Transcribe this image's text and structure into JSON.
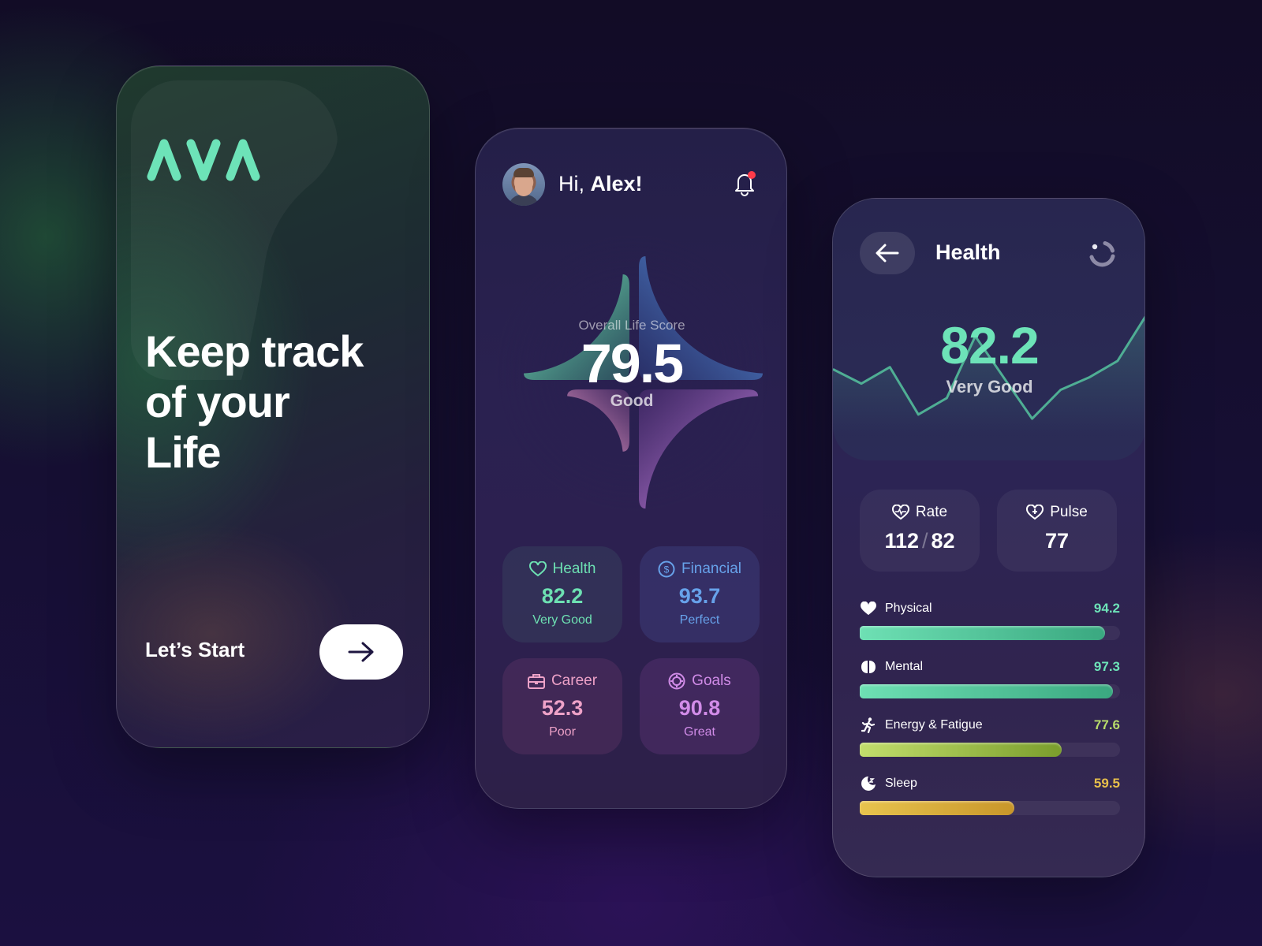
{
  "welcome": {
    "logo": "AVA",
    "headline": [
      "Keep track",
      "of your",
      "Life"
    ],
    "start_label": "Let’s Start",
    "start_button_icon": "arrow-right-icon",
    "accent": "#6de3b8"
  },
  "dashboard": {
    "greeting_prefix": "Hi,",
    "user_name": "Alex!",
    "notification_icon": "bell-icon",
    "has_notification": true,
    "score_label": "Overall Life Score",
    "score_value": "79.5",
    "score_status": "Good",
    "segments": [
      {
        "name": "Health",
        "value": 82.2,
        "color": "#6de3b8"
      },
      {
        "name": "Financial",
        "value": 93.7,
        "color": "#5a8fe0"
      },
      {
        "name": "Career",
        "value": 52.3,
        "color": "#e89bc6"
      },
      {
        "name": "Goals",
        "value": 90.8,
        "color": "#c98ae6"
      }
    ],
    "tiles": [
      {
        "label": "Health",
        "value": "82.2",
        "status": "Very Good",
        "icon": "heart-outline-icon",
        "color": "#6de0b2"
      },
      {
        "label": "Financial",
        "value": "93.7",
        "status": "Perfect",
        "icon": "dollar-circle-icon",
        "color": "#67a2ea"
      },
      {
        "label": "Career",
        "value": "52.3",
        "status": "Poor",
        "icon": "briefcase-icon",
        "color": "#eea2c8"
      },
      {
        "label": "Goals",
        "value": "90.8",
        "status": "Great",
        "icon": "target-icon",
        "color": "#d18ce8"
      }
    ]
  },
  "health": {
    "title": "Health",
    "back_icon": "arrow-left-icon",
    "refresh_icon": "loading-spinner-icon",
    "score_value": "82.2",
    "score_status": "Very Good",
    "trend_values": [
      62,
      55,
      63,
      40,
      48,
      78,
      58,
      38,
      52,
      58,
      66,
      88
    ],
    "vitals": [
      {
        "label": "Rate",
        "icon": "heart-pulse-icon",
        "systolic": "112",
        "separator": "/",
        "diastolic": "82"
      },
      {
        "label": "Pulse",
        "icon": "heart-plus-icon",
        "value": "77"
      }
    ],
    "metrics": [
      {
        "label": "Physical",
        "value": "94.2",
        "percent": 94.2,
        "icon": "heart-filled-icon",
        "color": "#6de3b8",
        "fill_from": "#6ee0b4",
        "fill_to": "#3aa880"
      },
      {
        "label": "Mental",
        "value": "97.3",
        "percent": 97.3,
        "icon": "brain-icon",
        "color": "#6de3b8",
        "fill_from": "#6ee0b4",
        "fill_to": "#3aa880"
      },
      {
        "label": "Energy & Fatigue",
        "value": "77.6",
        "percent": 77.6,
        "icon": "running-person-icon",
        "color": "#b8dc6a",
        "fill_from": "#c2de6c",
        "fill_to": "#7a9e2c"
      },
      {
        "label": "Sleep",
        "value": "59.5",
        "percent": 59.5,
        "icon": "moon-sleep-icon",
        "color": "#e8c04a",
        "fill_from": "#e8c44e",
        "fill_to": "#c8962a"
      }
    ]
  }
}
